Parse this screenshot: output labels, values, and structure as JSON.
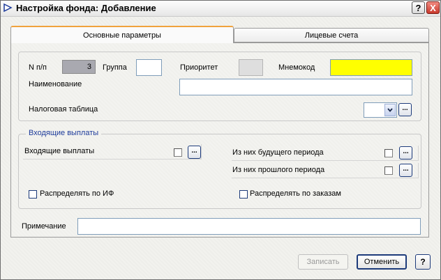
{
  "window": {
    "title": "Настройка фонда: Добавление"
  },
  "titlebar": {
    "help": "?",
    "close": "X"
  },
  "tabs": [
    {
      "label": "Основные параметры"
    },
    {
      "label": "Лицевые счета"
    }
  ],
  "main": {
    "n_pp_label": "N п/п",
    "n_pp_value": "3",
    "group_label": "Группа",
    "group_value": "",
    "priority_label": "Приоритет",
    "mnemocode_label": "Мнемокод",
    "mnemocode_value": "",
    "mnemocode_color": "#ffff00",
    "name_label": "Наименование",
    "name_value": "",
    "tax_table_label": "Налоговая таблица",
    "tax_table_value": "",
    "dots": "..."
  },
  "incoming": {
    "section_title": "Входящие выплаты",
    "incoming_label": "Входящие выплаты",
    "future_label": "Из них будущего периода",
    "past_label": "Из них прошлого периода",
    "distribute_if_label": "Распределять по ИФ",
    "distribute_orders_label": "Распределять по заказам"
  },
  "note": {
    "label": "Примечание",
    "value": ""
  },
  "footer": {
    "save_label": "Записать",
    "cancel_label": "Отменить",
    "help_label": "?"
  },
  "colors": {
    "accent_tab": "#f0a23c",
    "section_title": "#1c3a9a",
    "disabled_text": "#9a9a9a"
  }
}
